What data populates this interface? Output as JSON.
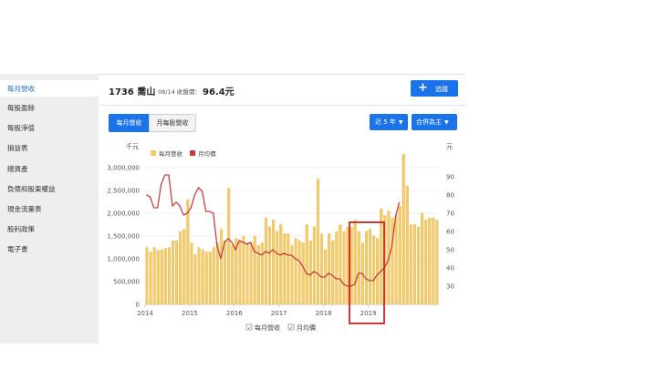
{
  "sidebar": {
    "items": [
      {
        "label": "每月營收",
        "active": true
      },
      {
        "label": "每股盈餘"
      },
      {
        "label": "每股淨值"
      },
      {
        "label": "損益表"
      },
      {
        "label": "總資產"
      },
      {
        "label": "負債和股東權益"
      },
      {
        "label": "現金流量表"
      },
      {
        "label": "股利政策"
      },
      {
        "label": "電子書"
      }
    ]
  },
  "header": {
    "stock": "1736 喬山",
    "price_label": "08/14 收盤價：",
    "price_value": "96.4元",
    "track_label": "追蹤"
  },
  "controls": {
    "tab_revenue": "每月營收",
    "tab_eps": "月每股營收",
    "range": "近 5 年",
    "basis": "合併為主"
  },
  "colors": {
    "accent": "#1a73e8",
    "bar": "#f2cc6a",
    "line": "#c44040",
    "highlight": "#cc2222"
  },
  "chart_data": {
    "type": "bar+line",
    "left_unit": "千元",
    "right_unit": "元",
    "left_ticks": [
      "0",
      "500,000",
      "1,000,000",
      "1,500,000",
      "2,000,000",
      "2,500,000",
      "3,000,000"
    ],
    "right_ticks": [
      "30",
      "40",
      "50",
      "60",
      "70",
      "80",
      "90"
    ],
    "x_ticks": [
      "2014",
      "2015",
      "2016",
      "2017",
      "2018",
      "2019"
    ],
    "ylim_left": [
      0,
      3000000
    ],
    "ylim_right": [
      20,
      95
    ],
    "legend_top": [
      "每月營收",
      "月均價"
    ],
    "legend_bottom": [
      "每月營收",
      "月均價"
    ],
    "series": [
      {
        "name": "每月營收",
        "type": "bar",
        "values": [
          1250000,
          1150000,
          1250000,
          1180000,
          1200000,
          1230000,
          1250000,
          1400000,
          1400000,
          1600000,
          1650000,
          2300000,
          1350000,
          1100000,
          1250000,
          1200000,
          1150000,
          1150000,
          1250000,
          1350000,
          1650000,
          1400000,
          2550000,
          1300000,
          1450000,
          1400000,
          1500000,
          1350000,
          1350000,
          1500000,
          1300000,
          1350000,
          1900000,
          1700000,
          1850000,
          1600000,
          1750000,
          1550000,
          1550000,
          1300000,
          1450000,
          1400000,
          1350000,
          1750000,
          1400000,
          1700000,
          2750000,
          1550000,
          1200000,
          1550000,
          1400000,
          1600000,
          1750000,
          1600000,
          1700000,
          1700000,
          1850000,
          1600000,
          1350000,
          1600000,
          1650000,
          1500000,
          1450000,
          2100000,
          1950000,
          2050000,
          1900000,
          1950000,
          2150000,
          3300000,
          2600000,
          1750000,
          1750000,
          1700000,
          2000000,
          1850000,
          1900000,
          1900000,
          1850000
        ]
      },
      {
        "name": "月均價",
        "type": "line",
        "values": [
          80,
          79,
          73,
          73,
          86,
          91,
          91,
          74,
          76,
          74,
          69,
          70,
          73,
          80,
          84,
          82,
          71,
          71,
          70,
          52,
          45,
          54,
          56,
          54,
          50,
          55,
          54,
          53,
          54,
          49,
          48,
          47,
          49,
          48,
          50,
          48,
          47,
          48,
          47,
          47,
          45,
          44,
          41,
          37,
          36,
          38,
          37,
          35,
          35,
          37,
          36,
          34,
          34,
          31,
          30,
          30,
          31,
          37,
          37,
          34,
          33,
          33,
          36,
          38,
          40,
          44,
          52,
          68,
          76
        ]
      }
    ],
    "annotations": [
      "red rectangle highlighting the 2018 period"
    ]
  }
}
